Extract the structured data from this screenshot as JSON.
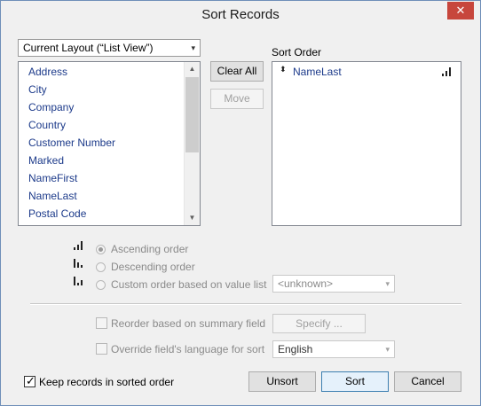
{
  "window": {
    "title": "Sort Records",
    "close_glyph": "✕"
  },
  "field_source": {
    "selected": "Current Layout (“List View”)",
    "arrow": "▾"
  },
  "fields": [
    {
      "label": "Address"
    },
    {
      "label": "City"
    },
    {
      "label": "Company"
    },
    {
      "label": "Country"
    },
    {
      "label": "Customer Number"
    },
    {
      "label": "Marked"
    },
    {
      "label": "NameFirst"
    },
    {
      "label": "NameLast"
    },
    {
      "label": "Postal Code"
    }
  ],
  "buttons": {
    "clear_all": "Clear All",
    "move": "Move",
    "specify": "Specify ...",
    "unsort": "Unsort",
    "sort": "Sort",
    "cancel": "Cancel"
  },
  "sort_order": {
    "heading": "Sort Order",
    "items": [
      {
        "field": "NameLast",
        "direction": "ascending"
      }
    ]
  },
  "order_options": {
    "ascending": "Ascending order",
    "descending": "Descending order",
    "custom": "Custom order based on value list",
    "value_list": "<unknown>",
    "selected": "ascending"
  },
  "options": {
    "reorder_summary": "Reorder based on summary field",
    "override_language": "Override field's language for sort",
    "language": "English",
    "keep_sorted": "Keep records in sorted order",
    "keep_sorted_checked": true
  }
}
